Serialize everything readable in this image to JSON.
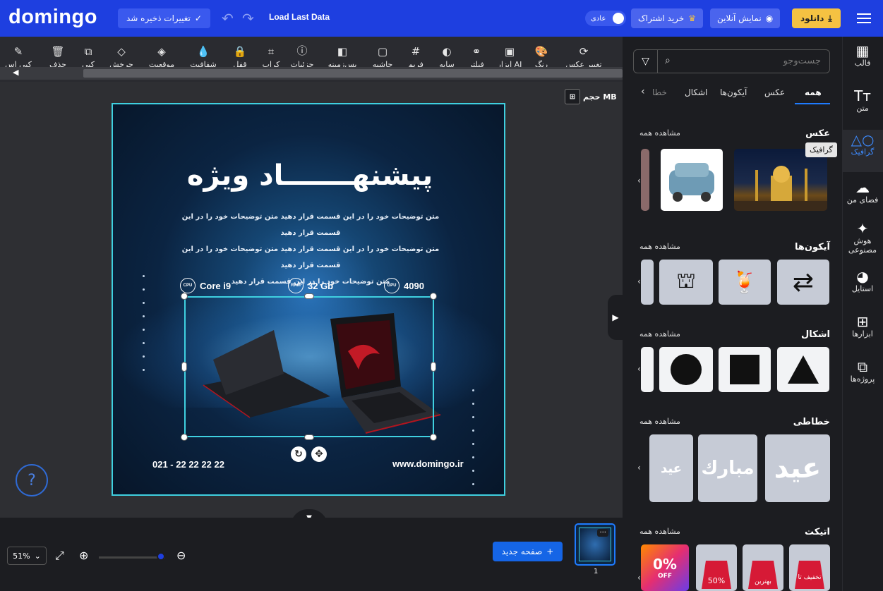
{
  "header": {
    "logo": "domingo",
    "saved_label": "تغییرات ذخیره شد",
    "load_last": "Load Last Data",
    "mode_label": "عادی",
    "subscribe_label": "خرید اشتراک",
    "online_label": "نمایش آنلاین",
    "download_label": "دانلود"
  },
  "toolbar": {
    "items": [
      "تغییر عکس",
      "رنگ",
      "ابزار AI",
      "فیلتر",
      "سایه",
      "فریم",
      "حاشیه",
      "پس‌زمینه",
      "جزئیات",
      "کراپ",
      "قفل",
      "شفافیت",
      "موقعیت",
      "چرخش",
      "کپی",
      "حذف",
      "کپی اس"
    ],
    "size_label": "حجم MB"
  },
  "poster": {
    "title": "پیشنهـــــــاد ویژه",
    "desc_line1": "متن توضیحات خود را در این قسمت قرار دهید متن توضیحات خود را در این قسمت قرار دهید",
    "desc_line2": "متن توضیحات خود را در این قسمت قرار دهید متن توضیحات خود را در این قسمت قرار دهید",
    "desc_line3": "متن توضیحات خود را در این قسمت قرار دهید",
    "cpu_badge": "CPU",
    "cpu": "Core i9",
    "ram_badge": "RAM",
    "ram": "32 Gb",
    "gpu_badge": "GPU",
    "gpu": "4090",
    "phone": "021 - 22 22 22 22",
    "website": "www.domingo.ir"
  },
  "bottom": {
    "zoom": "51%",
    "new_page": "صفحه جدید",
    "page_number": "1"
  },
  "panel": {
    "search_placeholder": "جست‌وجو",
    "tabs": [
      "همه",
      "عکس",
      "آیکون‌ها",
      "اشکال",
      "خطا"
    ],
    "active_tab": "همه",
    "see_all": "مشاهده همه",
    "sections": [
      "عکس",
      "آیکون‌ها",
      "اشکال",
      "خطاطی",
      "اتیکت"
    ],
    "tooltip": "گرافیک",
    "tag_texts": [
      "بهترین",
      "50%",
      "تخفیف تا"
    ],
    "pct_label": "0%",
    "off_label": "OFF"
  },
  "rail": {
    "items": [
      "قالب",
      "متن",
      "گرافیک",
      "فضای من",
      "هوش مصنوعی",
      "استایل",
      "ابزارها",
      "پروژه‌ها"
    ],
    "active": "گرافیک"
  },
  "colors": {
    "brand": "#1e3fe0",
    "accent": "#3fd0e0",
    "download": "#f5c242"
  }
}
